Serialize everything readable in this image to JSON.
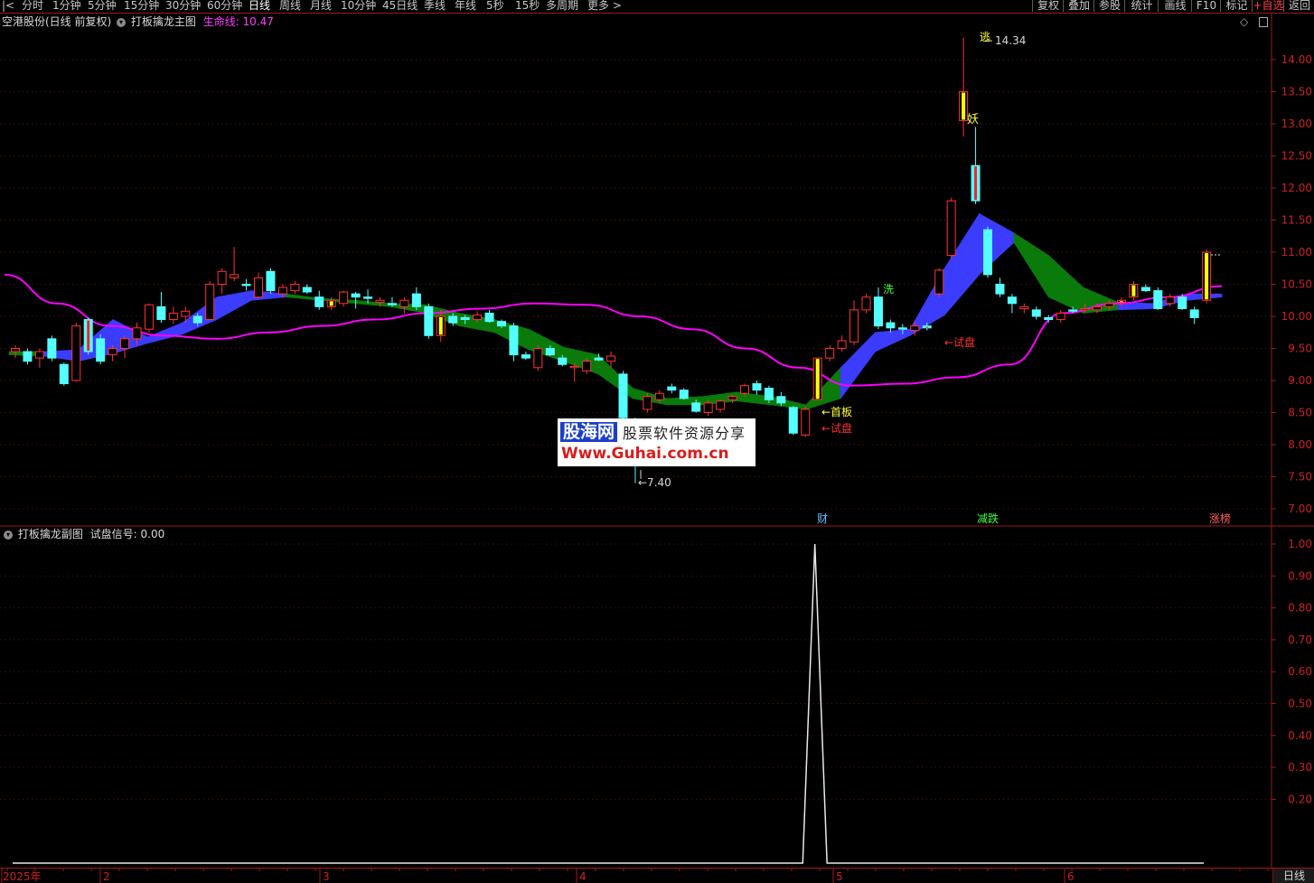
{
  "toolbar": {
    "periods": [
      "分时",
      "1分钟",
      "5分钟",
      "15分钟",
      "30分钟",
      "60分钟",
      "日线",
      "周线",
      "月线",
      "10分钟",
      "45日线",
      "季线",
      "年线",
      "5秒",
      "15秒",
      "多周期",
      "更多 >"
    ],
    "active_period": "日线",
    "right_buttons": [
      "复权",
      "叠加",
      "参股",
      "统计",
      "画线",
      "F10",
      "标记",
      "+自选",
      "返回"
    ]
  },
  "main_chart": {
    "stock_title": "空港股份(日线 前复权)",
    "indicator_name": "打板擒龙主图",
    "lifeline_label": "生命线: 10.47",
    "price_axis_labels": [
      "14.00",
      "13.50",
      "13.00",
      "12.50",
      "12.00",
      "11.50",
      "11.00",
      "10.50",
      "10.00",
      "9.50",
      "9.00",
      "8.50",
      "8.00",
      "7.50",
      "7.00"
    ],
    "annotations": {
      "high_label": "14.34",
      "low_label": "←7.40",
      "escape_label": "逃",
      "demon_label": "妖",
      "wash_label": "洗",
      "first_board_label": "←首板",
      "trial_label_1": "←试盘",
      "trial_label_2": "←试盘",
      "wealth_badge": "财",
      "reduce_drop_badge": "减跌",
      "limit_list_badge": "涨榜"
    }
  },
  "sub_chart": {
    "indicator_name": "打板擒龙副图",
    "signal_label": "试盘信号: 0.00",
    "axis_labels": [
      "1.00",
      "0.90",
      "0.80",
      "0.70",
      "0.60",
      "0.50",
      "0.40",
      "0.30",
      "0.20"
    ]
  },
  "date_axis": {
    "labels": [
      "2025年",
      "2",
      "3",
      "4",
      "5",
      "6"
    ]
  },
  "watermark": {
    "logo": "股海网",
    "tagline": "股票软件资源分享",
    "url": "Www.Guhai.com.cn"
  },
  "bottom_tab": "日线",
  "colors": {
    "up": "#ff3232",
    "down": "#54ffff",
    "lifeline": "#ff00ff",
    "band_up": "#3c3cff",
    "band_down": "#0a7a0a",
    "signal": "#ffff00"
  },
  "chart_data": {
    "type": "candlestick",
    "ylim": [
      6.9,
      14.5
    ],
    "sub_ylim": [
      0,
      1.05
    ],
    "candles": [
      {
        "o": 9.45,
        "h": 9.55,
        "l": 9.35,
        "c": 9.5
      },
      {
        "o": 9.45,
        "h": 9.5,
        "l": 9.25,
        "c": 9.3
      },
      {
        "o": 9.35,
        "h": 9.5,
        "l": 9.2,
        "c": 9.45
      },
      {
        "o": 9.65,
        "h": 9.7,
        "l": 9.3,
        "c": 9.35
      },
      {
        "o": 9.25,
        "h": 9.28,
        "l": 8.92,
        "c": 8.95
      },
      {
        "o": 9.0,
        "h": 9.9,
        "l": 8.98,
        "c": 9.85
      },
      {
        "o": 9.95,
        "h": 9.98,
        "l": 9.4,
        "c": 9.45
      },
      {
        "o": 9.65,
        "h": 9.72,
        "l": 9.25,
        "c": 9.3
      },
      {
        "o": 9.4,
        "h": 9.55,
        "l": 9.3,
        "c": 9.5
      },
      {
        "o": 9.5,
        "h": 9.7,
        "l": 9.35,
        "c": 9.65
      },
      {
        "o": 9.65,
        "h": 9.9,
        "l": 9.55,
        "c": 9.82
      },
      {
        "o": 9.8,
        "h": 10.2,
        "l": 9.75,
        "c": 10.18
      },
      {
        "o": 10.15,
        "h": 10.38,
        "l": 9.9,
        "c": 9.95
      },
      {
        "o": 9.95,
        "h": 10.15,
        "l": 9.88,
        "c": 10.05
      },
      {
        "o": 10.0,
        "h": 10.15,
        "l": 9.9,
        "c": 10.08
      },
      {
        "o": 10.0,
        "h": 10.05,
        "l": 9.85,
        "c": 9.9
      },
      {
        "o": 9.95,
        "h": 10.55,
        "l": 9.95,
        "c": 10.5
      },
      {
        "o": 10.5,
        "h": 10.75,
        "l": 10.35,
        "c": 10.7
      },
      {
        "o": 10.6,
        "h": 11.08,
        "l": 10.55,
        "c": 10.65
      },
      {
        "o": 10.5,
        "h": 10.58,
        "l": 10.4,
        "c": 10.48
      },
      {
        "o": 10.3,
        "h": 10.68,
        "l": 10.28,
        "c": 10.6
      },
      {
        "o": 10.7,
        "h": 10.75,
        "l": 10.35,
        "c": 10.4
      },
      {
        "o": 10.35,
        "h": 10.5,
        "l": 10.3,
        "c": 10.45
      },
      {
        "o": 10.4,
        "h": 10.55,
        "l": 10.35,
        "c": 10.5
      },
      {
        "o": 10.45,
        "h": 10.5,
        "l": 10.35,
        "c": 10.38
      },
      {
        "o": 10.3,
        "h": 10.4,
        "l": 10.1,
        "c": 10.15
      },
      {
        "o": 10.15,
        "h": 10.3,
        "l": 10.1,
        "c": 10.25
      },
      {
        "o": 10.2,
        "h": 10.4,
        "l": 10.15,
        "c": 10.38
      },
      {
        "o": 10.35,
        "h": 10.38,
        "l": 10.12,
        "c": 10.3
      },
      {
        "o": 10.3,
        "h": 10.42,
        "l": 10.2,
        "c": 10.28
      },
      {
        "o": 10.22,
        "h": 10.3,
        "l": 10.15,
        "c": 10.25
      },
      {
        "o": 10.2,
        "h": 10.3,
        "l": 10.15,
        "c": 10.18
      },
      {
        "o": 10.15,
        "h": 10.3,
        "l": 10.05,
        "c": 10.25
      },
      {
        "o": 10.35,
        "h": 10.45,
        "l": 10.1,
        "c": 10.15
      },
      {
        "o": 10.15,
        "h": 10.2,
        "l": 9.65,
        "c": 9.7
      },
      {
        "o": 9.7,
        "h": 10.1,
        "l": 9.6,
        "c": 10.0
      },
      {
        "o": 10.0,
        "h": 10.05,
        "l": 9.85,
        "c": 9.9
      },
      {
        "o": 9.98,
        "h": 10.02,
        "l": 9.88,
        "c": 9.95
      },
      {
        "o": 9.95,
        "h": 10.08,
        "l": 9.9,
        "c": 10.02
      },
      {
        "o": 10.05,
        "h": 10.1,
        "l": 9.9,
        "c": 9.92
      },
      {
        "o": 9.92,
        "h": 9.95,
        "l": 9.82,
        "c": 9.85
      },
      {
        "o": 9.85,
        "h": 9.9,
        "l": 9.3,
        "c": 9.4
      },
      {
        "o": 9.4,
        "h": 9.45,
        "l": 9.32,
        "c": 9.35
      },
      {
        "o": 9.2,
        "h": 9.55,
        "l": 9.15,
        "c": 9.5
      },
      {
        "o": 9.5,
        "h": 9.55,
        "l": 9.38,
        "c": 9.4
      },
      {
        "o": 9.35,
        "h": 9.4,
        "l": 9.22,
        "c": 9.25
      },
      {
        "o": 9.2,
        "h": 9.28,
        "l": 8.98,
        "c": 9.22
      },
      {
        "o": 9.15,
        "h": 9.35,
        "l": 9.1,
        "c": 9.3
      },
      {
        "o": 9.35,
        "h": 9.42,
        "l": 9.3,
        "c": 9.32
      },
      {
        "o": 9.3,
        "h": 9.45,
        "l": 9.2,
        "c": 9.38
      },
      {
        "o": 9.1,
        "h": 9.15,
        "l": 8.38,
        "c": 8.42
      },
      {
        "o": 8.4,
        "h": 8.42,
        "l": 7.4,
        "c": 8.38
      },
      {
        "o": 8.55,
        "h": 8.8,
        "l": 8.5,
        "c": 8.75
      },
      {
        "o": 8.7,
        "h": 8.85,
        "l": 8.65,
        "c": 8.8
      },
      {
        "o": 8.9,
        "h": 8.95,
        "l": 8.8,
        "c": 8.85
      },
      {
        "o": 8.85,
        "h": 8.88,
        "l": 8.7,
        "c": 8.72
      },
      {
        "o": 8.65,
        "h": 8.7,
        "l": 8.5,
        "c": 8.52
      },
      {
        "o": 8.5,
        "h": 8.7,
        "l": 8.45,
        "c": 8.65
      },
      {
        "o": 8.55,
        "h": 8.7,
        "l": 8.5,
        "c": 8.68
      },
      {
        "o": 8.7,
        "h": 8.78,
        "l": 8.65,
        "c": 8.75
      },
      {
        "o": 8.8,
        "h": 8.95,
        "l": 8.75,
        "c": 8.92
      },
      {
        "o": 8.95,
        "h": 9.0,
        "l": 8.78,
        "c": 8.85
      },
      {
        "o": 8.88,
        "h": 8.92,
        "l": 8.65,
        "c": 8.7
      },
      {
        "o": 8.75,
        "h": 8.82,
        "l": 8.6,
        "c": 8.65
      },
      {
        "o": 8.58,
        "h": 8.6,
        "l": 8.15,
        "c": 8.18
      },
      {
        "o": 8.15,
        "h": 8.6,
        "l": 8.12,
        "c": 8.55
      },
      {
        "o": 8.7,
        "h": 9.35,
        "l": 8.7,
        "c": 9.35
      },
      {
        "o": 9.35,
        "h": 9.55,
        "l": 9.3,
        "c": 9.5
      },
      {
        "o": 9.5,
        "h": 9.7,
        "l": 9.45,
        "c": 9.62
      },
      {
        "o": 9.6,
        "h": 10.25,
        "l": 9.55,
        "c": 10.1
      },
      {
        "o": 10.1,
        "h": 10.35,
        "l": 10.05,
        "c": 10.3
      },
      {
        "o": 10.3,
        "h": 10.45,
        "l": 9.8,
        "c": 9.85
      },
      {
        "o": 9.9,
        "h": 9.95,
        "l": 9.75,
        "c": 9.82
      },
      {
        "o": 9.82,
        "h": 9.88,
        "l": 9.72,
        "c": 9.8
      },
      {
        "o": 9.78,
        "h": 9.92,
        "l": 9.7,
        "c": 9.85
      },
      {
        "o": 9.85,
        "h": 9.9,
        "l": 9.78,
        "c": 9.82
      },
      {
        "o": 10.35,
        "h": 10.75,
        "l": 10.3,
        "c": 10.72
      },
      {
        "o": 10.95,
        "h": 11.85,
        "l": 10.9,
        "c": 11.8
      },
      {
        "o": 13.05,
        "h": 14.34,
        "l": 12.8,
        "c": 13.5
      },
      {
        "o": 12.35,
        "h": 12.95,
        "l": 11.75,
        "c": 11.8
      },
      {
        "o": 11.35,
        "h": 11.4,
        "l": 10.6,
        "c": 10.65
      },
      {
        "o": 10.5,
        "h": 10.6,
        "l": 10.3,
        "c": 10.35
      },
      {
        "o": 10.3,
        "h": 10.35,
        "l": 10.05,
        "c": 10.2
      },
      {
        "o": 10.12,
        "h": 10.2,
        "l": 10.05,
        "c": 10.15
      },
      {
        "o": 10.1,
        "h": 10.15,
        "l": 9.95,
        "c": 10.0
      },
      {
        "o": 9.98,
        "h": 10.02,
        "l": 9.9,
        "c": 9.95
      },
      {
        "o": 9.95,
        "h": 10.1,
        "l": 9.9,
        "c": 10.05
      },
      {
        "o": 10.1,
        "h": 10.15,
        "l": 10.05,
        "c": 10.08
      },
      {
        "o": 10.1,
        "h": 10.2,
        "l": 10.05,
        "c": 10.12
      },
      {
        "o": 10.1,
        "h": 10.2,
        "l": 10.05,
        "c": 10.15
      },
      {
        "o": 10.15,
        "h": 10.25,
        "l": 10.1,
        "c": 10.2
      },
      {
        "o": 10.22,
        "h": 10.3,
        "l": 10.15,
        "c": 10.25
      },
      {
        "o": 10.3,
        "h": 10.55,
        "l": 10.25,
        "c": 10.5
      },
      {
        "o": 10.45,
        "h": 10.5,
        "l": 10.38,
        "c": 10.4
      },
      {
        "o": 10.4,
        "h": 10.45,
        "l": 10.1,
        "c": 10.12
      },
      {
        "o": 10.2,
        "h": 10.35,
        "l": 10.15,
        "c": 10.3
      },
      {
        "o": 10.3,
        "h": 10.35,
        "l": 10.1,
        "c": 10.12
      },
      {
        "o": 10.1,
        "h": 10.15,
        "l": 9.88,
        "c": 9.98
      },
      {
        "o": 10.25,
        "h": 11.05,
        "l": 10.2,
        "c": 11.0
      }
    ],
    "highlighted_candles": [
      6,
      26,
      35,
      66,
      75,
      78,
      79,
      91,
      92,
      98
    ],
    "lifeline": [
      10.65,
      10.2,
      9.85,
      9.7,
      9.65,
      9.75,
      9.85,
      9.95,
      10.05,
      10.12,
      10.2,
      10.18,
      10.0,
      9.8,
      9.5,
      9.2,
      8.92,
      8.95,
      9.05,
      9.25,
      10.05,
      10.2,
      10.3,
      10.47
    ],
    "band_upper": [
      9.45,
      9.45,
      9.48,
      9.95,
      9.68,
      9.9,
      10.3,
      10.4,
      10.35,
      10.28,
      10.25,
      10.2,
      10.18,
      10.05,
      9.95,
      9.8,
      9.52,
      9.4,
      8.88,
      8.72,
      8.75,
      8.82,
      8.75,
      8.62,
      9.2,
      9.75,
      9.8,
      10.75,
      11.6,
      11.3,
      10.95,
      10.45,
      10.22,
      10.2,
      10.35,
      10.35
    ],
    "band_lower": [
      9.4,
      9.38,
      9.3,
      9.42,
      9.58,
      9.72,
      9.95,
      10.25,
      10.3,
      10.25,
      10.2,
      10.15,
      10.05,
      9.85,
      9.75,
      9.48,
      9.3,
      9.1,
      8.72,
      8.62,
      8.62,
      8.68,
      8.62,
      8.55,
      8.72,
      9.45,
      9.7,
      10.02,
      10.65,
      11.15,
      10.3,
      10.05,
      10.1,
      10.12,
      10.25,
      10.3
    ],
    "band_trend": [
      "down",
      "up",
      "up",
      "up",
      "up",
      "up",
      "up",
      "up",
      "down",
      "down",
      "down",
      "down",
      "down",
      "down",
      "down",
      "down",
      "down",
      "down",
      "down",
      "down",
      "down",
      "down",
      "down",
      "down",
      "up",
      "up",
      "up",
      "up",
      "up",
      "down",
      "down",
      "down",
      "up",
      "up",
      "up",
      "up"
    ],
    "signal": [
      0,
      0,
      0,
      0,
      0,
      0,
      0,
      0,
      0,
      0,
      0,
      0,
      0,
      0,
      0,
      0,
      0,
      0,
      0,
      0,
      0,
      0,
      0,
      0,
      0,
      0,
      0,
      0,
      0,
      0,
      0,
      0,
      0,
      0,
      0,
      0,
      0,
      0,
      0,
      0,
      0,
      0,
      0,
      0,
      0,
      0,
      0,
      0,
      0,
      0,
      0,
      0,
      0,
      0,
      0,
      0,
      0,
      0,
      0,
      0,
      0,
      0,
      0,
      0,
      0,
      0,
      1,
      0,
      0,
      0,
      0,
      0,
      0,
      0,
      0,
      0,
      0,
      0,
      0,
      0,
      0,
      0,
      0,
      0,
      0,
      0,
      0,
      0,
      0,
      0,
      0,
      0,
      0,
      0,
      0,
      0,
      0,
      0,
      0
    ]
  }
}
